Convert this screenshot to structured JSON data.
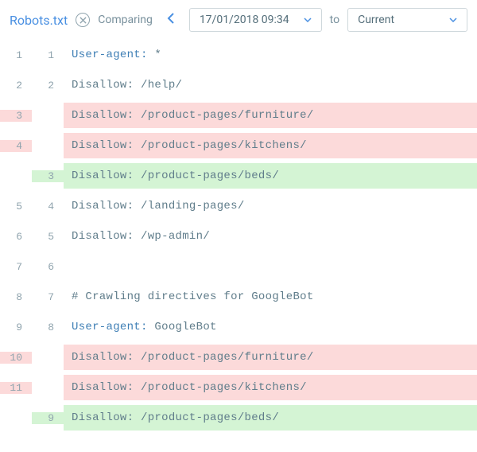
{
  "header": {
    "title": "Robots.txt",
    "comparing_label": "Comparing",
    "from_date": "17/01/2018 09:34",
    "to_label": "to",
    "to_date": "Current"
  },
  "diff": {
    "lines": [
      {
        "left": "1",
        "right": "1",
        "status": "unchanged",
        "text": "User-agent: *",
        "keyword": "User-agent:"
      },
      {
        "left": "2",
        "right": "2",
        "status": "unchanged",
        "text": "Disallow: /help/"
      },
      {
        "left": "3",
        "right": "",
        "status": "removed",
        "text": "Disallow: /product-pages/furniture/"
      },
      {
        "left": "4",
        "right": "",
        "status": "removed",
        "text": "Disallow: /product-pages/kitchens/"
      },
      {
        "left": "",
        "right": "3",
        "status": "added",
        "text": "Disallow: /product-pages/beds/"
      },
      {
        "left": "5",
        "right": "4",
        "status": "unchanged",
        "text": "Disallow: /landing-pages/"
      },
      {
        "left": "6",
        "right": "5",
        "status": "unchanged",
        "text": "Disallow: /wp-admin/"
      },
      {
        "left": "7",
        "right": "6",
        "status": "unchanged",
        "text": ""
      },
      {
        "left": "8",
        "right": "7",
        "status": "unchanged",
        "text": "# Crawling directives for GoogleBot"
      },
      {
        "left": "9",
        "right": "8",
        "status": "unchanged",
        "text": "User-agent: GoogleBot",
        "keyword": "User-agent:"
      },
      {
        "left": "10",
        "right": "",
        "status": "removed",
        "text": "Disallow: /product-pages/furniture/"
      },
      {
        "left": "11",
        "right": "",
        "status": "removed",
        "text": "Disallow: /product-pages/kitchens/"
      },
      {
        "left": "",
        "right": "9",
        "status": "added",
        "text": "Disallow: /product-pages/beds/"
      }
    ]
  }
}
